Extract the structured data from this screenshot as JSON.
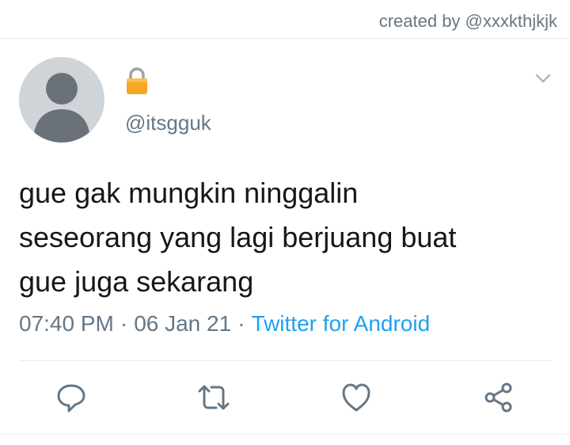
{
  "credit": "created by @xxxkthjkjk",
  "user": {
    "handle": "@itsgguk",
    "protected_icon": "lock-icon"
  },
  "tweet": {
    "text_lines": [
      "gue gak mungkin ninggalin",
      "seseorang yang lagi berjuang buat",
      "gue juga sekarang"
    ],
    "time": "07:40 PM",
    "date": "06 Jan 21",
    "separator": "·",
    "source": "Twitter for Android"
  },
  "actions": [
    "reply-icon",
    "retweet-icon",
    "like-icon",
    "share-icon"
  ],
  "colors": {
    "link": "#1da1f2",
    "muted": "#657786",
    "text": "#14171a",
    "lock": "#f5a623"
  }
}
